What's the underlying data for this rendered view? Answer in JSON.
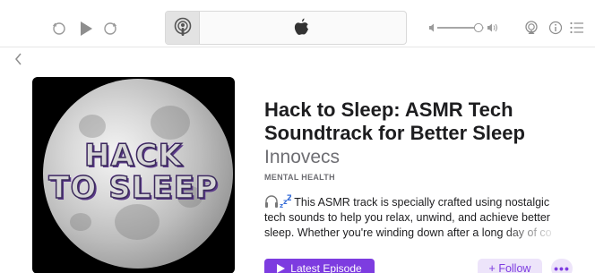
{
  "toolbar": {
    "skip_back_icon": "skip-back-icon",
    "play_icon": "play-icon",
    "skip_forward_icon": "skip-forward-icon",
    "podcast_icon": "podcasts-app-icon",
    "apple_icon": "apple-logo-icon",
    "volume": 0.75,
    "airplay_icon": "airplay-icon",
    "info_icon": "info-icon",
    "list_icon": "list-icon"
  },
  "nav": {
    "back_icon": "chevron-left-icon"
  },
  "show": {
    "artwork_line1": "HACK",
    "artwork_line2": "TO SLEEP",
    "title": "Hack to Sleep: ASMR Tech Soundtrack for Better Sleep",
    "author": "Innovecs",
    "category": "MENTAL HEALTH",
    "description": "This ASMR track is specially crafted using nostalgic tech sounds to help you relax, unwind, and achieve better sleep. Whether you're winding down after a long day of co",
    "latest_label": "Latest Episode",
    "follow_label": "+ Follow",
    "more_label": "•••"
  },
  "colors": {
    "accent": "#7d3ce0",
    "accent_light": "#ede4fa"
  }
}
